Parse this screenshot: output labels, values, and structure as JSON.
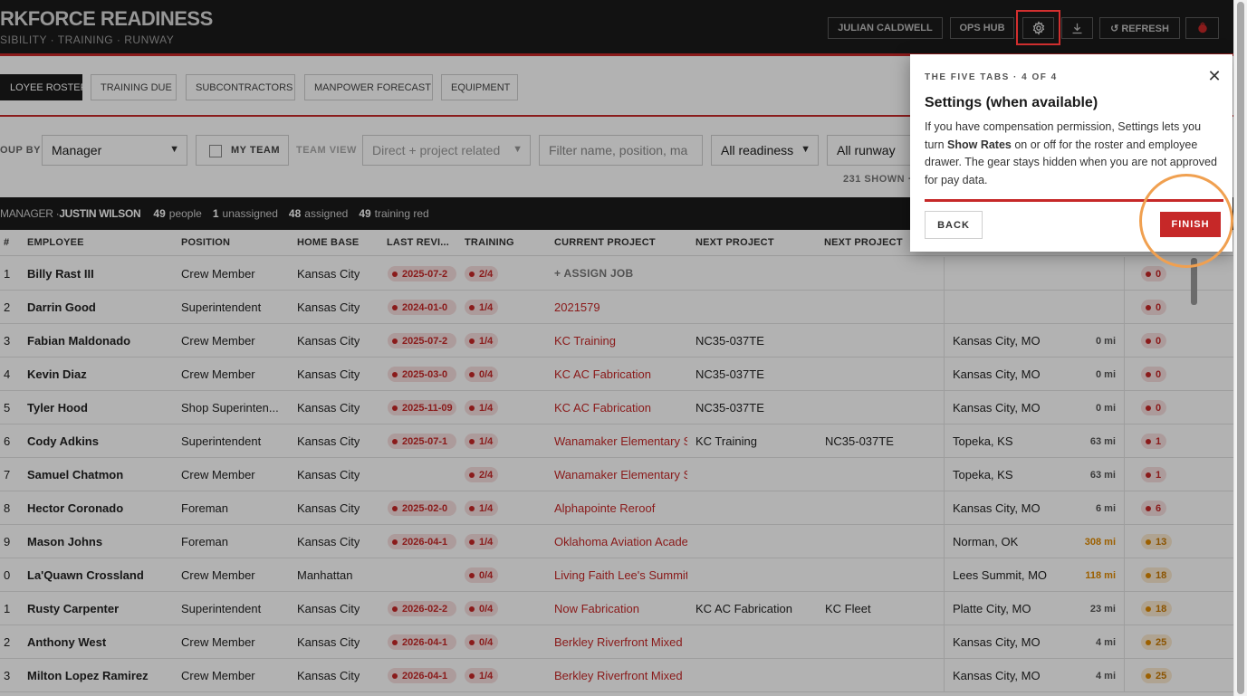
{
  "header": {
    "title": "RKFORCE READINESS",
    "subtitle": "SIBILITY · TRAINING · RUNWAY",
    "user_button": "JULIAN CALDWELL",
    "ops_hub_button": "OPS HUB",
    "settings_icon": "gear-icon",
    "download_icon": "download-icon",
    "refresh_button": "↺ REFRESH",
    "logo_icon": "brand-logo-icon",
    "accent_color": "#c62828"
  },
  "tabs": [
    {
      "label": "LOYEE ROSTER",
      "active": true
    },
    {
      "label": "TRAINING DUE"
    },
    {
      "label": "SUBCONTRACTORS"
    },
    {
      "label": "MANPOWER FORECAST"
    },
    {
      "label": "EQUIPMENT"
    }
  ],
  "filters": {
    "group_by_label": "OUP BY",
    "group_by_value": "Manager",
    "my_team_label": "MY TEAM",
    "team_view_label": "TEAM VIEW",
    "team_view_value": "Direct + project related",
    "search_placeholder": "Filter name, position, ma",
    "readiness_value": "All readiness",
    "runway_value": "All runway",
    "shown_count": "231 SHOWN ·"
  },
  "manager_bar": {
    "label": "MANAGER · ",
    "name": "JUSTIN WILSON",
    "people_count": "49",
    "people_label": "people",
    "unassigned_count": "1",
    "unassigned_label": "unassigned",
    "assigned_count": "48",
    "assigned_label": "assigned",
    "training_count": "49",
    "training_label": "training red"
  },
  "columns": {
    "num": "#",
    "employee": "EMPLOYEE",
    "position": "POSITION",
    "home_base": "HOME BASE",
    "last_review": "LAST REVI...",
    "training": "TRAINING",
    "current_project": "CURRENT PROJECT",
    "next_project_1": "NEXT PROJECT",
    "next_project_2": "NEXT PROJECT"
  },
  "assign_job_label": "+ ASSIGN JOB",
  "rows": [
    {
      "num": "1",
      "name": "Billy Rast III",
      "position": "Crew Member",
      "home": "Kansas City",
      "review": "2025-07-2",
      "training": "2/4",
      "project": "",
      "next1": "",
      "next2": "",
      "location": "",
      "distance": "",
      "score": "0",
      "assign": true
    },
    {
      "num": "2",
      "name": "Darrin Good",
      "position": "Superintendent",
      "home": "Kansas City",
      "review": "2024-01-0",
      "training": "1/4",
      "project": "2021579",
      "next1": "",
      "next2": "",
      "location": "",
      "distance": "",
      "score": "0"
    },
    {
      "num": "3",
      "name": "Fabian Maldonado",
      "position": "Crew Member",
      "home": "Kansas City",
      "review": "2025-07-2",
      "training": "1/4",
      "project": "KC Training",
      "next1": "NC35-037TE",
      "next2": "",
      "location": "Kansas City, MO",
      "distance": "0 mi",
      "score": "0"
    },
    {
      "num": "4",
      "name": "Kevin Diaz",
      "position": "Crew Member",
      "home": "Kansas City",
      "review": "2025-03-0",
      "training": "0/4",
      "project": "KC AC Fabrication",
      "next1": "NC35-037TE",
      "next2": "",
      "location": "Kansas City, MO",
      "distance": "0 mi",
      "score": "0"
    },
    {
      "num": "5",
      "name": "Tyler Hood",
      "position": "Shop Superinten...",
      "home": "Kansas City",
      "review": "2025-11-09",
      "training": "1/4",
      "project": "KC AC Fabrication",
      "next1": "NC35-037TE",
      "next2": "",
      "location": "Kansas City, MO",
      "distance": "0 mi",
      "score": "0"
    },
    {
      "num": "6",
      "name": "Cody Adkins",
      "position": "Superintendent",
      "home": "Kansas City",
      "review": "2025-07-1",
      "training": "1/4",
      "project": "Wanamaker Elementary S",
      "next1": "KC Training",
      "next2": "NC35-037TE",
      "location": "Topeka, KS",
      "distance": "63 mi",
      "score": "1"
    },
    {
      "num": "7",
      "name": "Samuel Chatmon",
      "position": "Crew Member",
      "home": "Kansas City",
      "review": "",
      "training": "2/4",
      "project": "Wanamaker Elementary S",
      "next1": "",
      "next2": "",
      "location": "Topeka, KS",
      "distance": "63 mi",
      "score": "1"
    },
    {
      "num": "8",
      "name": "Hector Coronado",
      "position": "Foreman",
      "home": "Kansas City",
      "review": "2025-02-0",
      "training": "1/4",
      "project": "Alphapointe Reroof",
      "next1": "",
      "next2": "",
      "location": "Kansas City, MO",
      "distance": "6 mi",
      "score": "6"
    },
    {
      "num": "9",
      "name": "Mason Johns",
      "position": "Foreman",
      "home": "Kansas City",
      "review": "2026-04-1",
      "training": "1/4",
      "project": "Oklahoma Aviation Acade",
      "next1": "",
      "next2": "",
      "location": "Norman, OK",
      "distance": "308 mi",
      "score": "13",
      "warn": true
    },
    {
      "num": "0",
      "name": "La'Quawn Crossland",
      "position": "Crew Member",
      "home": "Manhattan",
      "review": "",
      "training": "0/4",
      "project": "Living Faith Lee's Summit",
      "next1": "",
      "next2": "",
      "location": "Lees Summit, MO",
      "distance": "118 mi",
      "score": "18",
      "warn": true
    },
    {
      "num": "1",
      "name": "Rusty Carpenter",
      "position": "Superintendent",
      "home": "Kansas City",
      "review": "2026-02-2",
      "training": "0/4",
      "project": "Now Fabrication",
      "next1": "KC AC Fabrication",
      "next2": "KC Fleet",
      "location": "Platte City, MO",
      "distance": "23 mi",
      "score": "18",
      "amber": true
    },
    {
      "num": "2",
      "name": "Anthony West",
      "position": "Crew Member",
      "home": "Kansas City",
      "review": "2026-04-1",
      "training": "0/4",
      "project": "Berkley Riverfront Mixed",
      "next1": "",
      "next2": "",
      "location": "Kansas City, MO",
      "distance": "4 mi",
      "score": "25",
      "amber": true
    },
    {
      "num": "3",
      "name": "Milton Lopez Ramirez",
      "position": "Crew Member",
      "home": "Kansas City",
      "review": "2026-04-1",
      "training": "1/4",
      "project": "Berkley Riverfront Mixed",
      "next1": "",
      "next2": "",
      "location": "Kansas City, MO",
      "distance": "4 mi",
      "score": "25",
      "amber": true
    }
  ],
  "tour": {
    "step": "THE FIVE TABS · 4 OF 4",
    "title": "Settings (when available)",
    "body_1": "If you have compensation permission, Settings lets you turn ",
    "body_bold": "Show Rates",
    "body_2": " on or off for the roster and employee drawer. The gear stays hidden when you are not approved for pay data.",
    "back_label": "BACK",
    "finish_label": "FINISH",
    "close_icon": "close-icon"
  }
}
